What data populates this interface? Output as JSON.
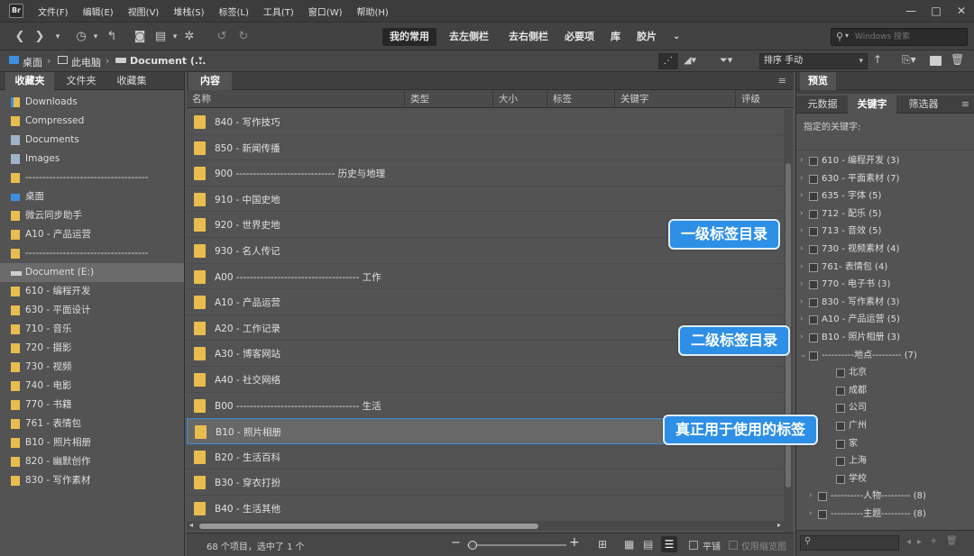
{
  "menubar": {
    "logo": "Br",
    "items": [
      "文件(F)",
      "编辑(E)",
      "视图(V)",
      "堆栈(S)",
      "标签(L)",
      "工具(T)",
      "窗口(W)",
      "帮助(H)"
    ]
  },
  "toolbar": {
    "workspaces": [
      "我的常用",
      "去左侧栏",
      "去右侧栏",
      "必要项",
      "库",
      "胶片"
    ],
    "search_placeholder": "Windows 搜索",
    "search_icon": "search-icon"
  },
  "pathbar": {
    "crumbs": [
      "桌面",
      "此电脑",
      "Document (..."
    ],
    "sort_label": "排序 手动"
  },
  "left_panel": {
    "tabs": [
      "收藏夹",
      "文件夹",
      "收藏集"
    ],
    "items": [
      {
        "label": "Downloads",
        "icon": "download-folder-icon"
      },
      {
        "label": "Compressed",
        "icon": "folder-icon"
      },
      {
        "label": "Documents",
        "icon": "document-icon"
      },
      {
        "label": "Images",
        "icon": "image-icon"
      },
      {
        "label": "------------------------------------",
        "icon": "folder-icon"
      },
      {
        "label": "桌面",
        "icon": "desktop-icon"
      },
      {
        "label": "微云同步助手",
        "icon": "cloud-folder-icon"
      },
      {
        "label": "A10 - 产品运营",
        "icon": "folder-icon"
      },
      {
        "label": "------------------------------------",
        "icon": "folder-icon"
      },
      {
        "label": "Document (E:)",
        "icon": "drive-icon",
        "selected": true
      },
      {
        "label": "610 - 编程开发",
        "icon": "folder-icon"
      },
      {
        "label": "630 - 平面设计",
        "icon": "folder-icon"
      },
      {
        "label": "710 - 音乐",
        "icon": "folder-icon"
      },
      {
        "label": "720 - 摄影",
        "icon": "folder-icon"
      },
      {
        "label": "730 - 视频",
        "icon": "folder-icon"
      },
      {
        "label": "740 - 电影",
        "icon": "folder-icon"
      },
      {
        "label": "770 - 书籍",
        "icon": "folder-icon"
      },
      {
        "label": "761 - 表情包",
        "icon": "folder-icon"
      },
      {
        "label": "B10 - 照片相册",
        "icon": "folder-icon"
      },
      {
        "label": "820 - 幽默创作",
        "icon": "folder-icon"
      },
      {
        "label": "830 - 写作素材",
        "icon": "folder-icon"
      }
    ]
  },
  "content": {
    "tab": "内容",
    "columns": [
      "名称",
      "类型",
      "大小",
      "标签",
      "关键字",
      "评级"
    ],
    "rows": [
      {
        "label": "840 - 写作技巧"
      },
      {
        "label": "850 - 新闻传播"
      },
      {
        "label": "900 ----------------------------- 历史与地理"
      },
      {
        "label": "910 - 中国史地"
      },
      {
        "label": "920 - 世界史地"
      },
      {
        "label": "930 - 名人传记"
      },
      {
        "label": "A00 ------------------------------------ 工作"
      },
      {
        "label": "A10 - 产品运营"
      },
      {
        "label": "A20 - 工作记录"
      },
      {
        "label": "A30 - 博客网站"
      },
      {
        "label": "A40 - 社交网络"
      },
      {
        "label": "B00 ------------------------------------ 生活"
      },
      {
        "label": "B10 - 照片相册",
        "selected": true
      },
      {
        "label": "B20 - 生活百科"
      },
      {
        "label": "B30 - 穿衣打扮"
      },
      {
        "label": "B40 - 生活其他"
      }
    ],
    "status": "68 个项目，选中了 1 个",
    "zoom_level": 0.05,
    "thumbnail_lock_label": "平铺",
    "filter_only_label": "仅限缩览图"
  },
  "right_panel": {
    "preview_tab": "预览",
    "tabs": [
      "元数据",
      "关键字",
      "筛选器"
    ],
    "assigned_label": "指定的关键字:",
    "keywords": [
      {
        "label": "610 - 编程开发 (3)",
        "level": 0,
        "expandable": true
      },
      {
        "label": "630 - 平面素材 (7)",
        "level": 0,
        "expandable": true
      },
      {
        "label": "635 - 字体 (5)",
        "level": 0,
        "expandable": true
      },
      {
        "label": "712 - 配乐 (5)",
        "level": 0,
        "expandable": true
      },
      {
        "label": "713 - 音效 (5)",
        "level": 0,
        "expandable": true
      },
      {
        "label": "730 - 视频素材 (4)",
        "level": 0,
        "expandable": true
      },
      {
        "label": "761- 表情包 (4)",
        "level": 0,
        "expandable": true
      },
      {
        "label": "770 - 电子书 (3)",
        "level": 0,
        "expandable": true
      },
      {
        "label": "830 - 写作素材 (3)",
        "level": 0,
        "expandable": true
      },
      {
        "label": "A10 - 产品运营 (5)",
        "level": 0,
        "expandable": true
      },
      {
        "label": "B10 - 照片相册 (3)",
        "level": 0,
        "expandable": true
      },
      {
        "label": "----------地点--------- (7)",
        "level": 0,
        "expandable": true,
        "expanded": true
      },
      {
        "label": "北京",
        "level": 1
      },
      {
        "label": "成都",
        "level": 1
      },
      {
        "label": "公司",
        "level": 1
      },
      {
        "label": "广州",
        "level": 1
      },
      {
        "label": "家",
        "level": 1
      },
      {
        "label": "上海",
        "level": 1
      },
      {
        "label": "学校",
        "level": 1
      },
      {
        "label": "----------人物--------- (8)",
        "level": 0,
        "expandable": true
      },
      {
        "label": "----------主题--------- (8)",
        "level": 0,
        "expandable": true
      }
    ]
  },
  "callouts": {
    "level1": "一级标签目录",
    "level2": "二级标签目录",
    "actual": "真正用于使用的标签"
  },
  "colors": {
    "accent": "#2d8fe6",
    "folder": "#e8bd4f",
    "panel_bg": "#535353"
  }
}
